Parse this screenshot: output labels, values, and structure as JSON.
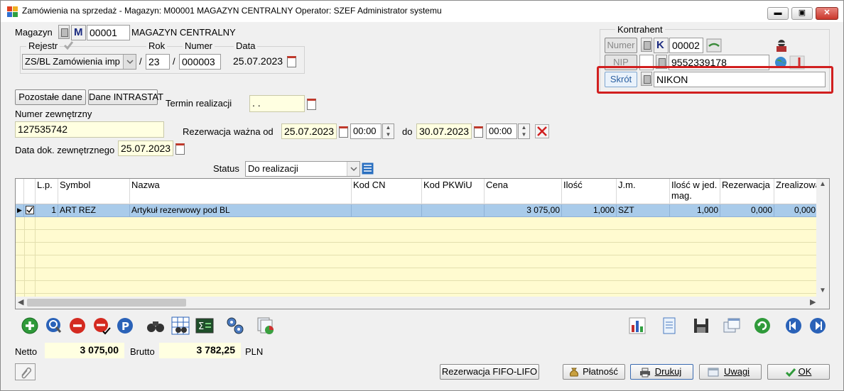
{
  "window": {
    "title": "Zamówienia na sprzedaż - Magazyn: M00001 MAGAZYN CENTRALNY  Operator: SZEF Administrator systemu",
    "min_label": "▬",
    "max_label": "▣",
    "close_label": "✕"
  },
  "magazyn": {
    "label": "Magazyn",
    "prefix": "M",
    "code": "00001",
    "name": "MAGAZYN CENTRALNY"
  },
  "rejestr": {
    "label": "Rejestr",
    "value": "ZS/BL Zamówienia imp",
    "rok_label": "Rok",
    "rok": "23",
    "numer_label": "Numer",
    "numer": "000003",
    "data_label": "Data",
    "data": "25.07.2023",
    "sep1": "/",
    "sep2": "/"
  },
  "kontrahent": {
    "label": "Kontrahent",
    "numer_label": "Numer",
    "prefix": "K",
    "numer": "00002",
    "nip_label": "NIP",
    "nip": "9552339178",
    "skrot_label": "Skrót",
    "skrot": "NIKON"
  },
  "buttons": {
    "pozostale": "Pozostałe dane",
    "intrastat": "Dane INTRASTAT",
    "fifo": "Rezerwacja FIFO-LIFO",
    "platnosc": "Płatność",
    "drukuj": "Drukuj",
    "uwagi": "Uwagi",
    "ok": "OK"
  },
  "termin": {
    "label": "Termin realizacji",
    "value": " .  ."
  },
  "numer_zew": {
    "label": "Numer zewnętrzny",
    "value": "127535742"
  },
  "rezerwacja": {
    "label": "Rezerwacja",
    "wazna_label": "ważna od",
    "od_date": "25.07.2023",
    "od_time": "00:00",
    "do_label": "do",
    "do_date": "30.07.2023",
    "do_time": "00:00"
  },
  "data_zew": {
    "label": "Data dok. zewnętrznego",
    "value": "25.07.2023"
  },
  "status": {
    "label": "Status",
    "value": "Do realizacji"
  },
  "grid": {
    "columns": [
      "L.p.",
      "Symbol",
      "Nazwa",
      "Kod CN",
      "Kod PKWiU",
      "Cena",
      "Ilość",
      "J.m.",
      "Ilość w jed. mag.",
      "Rezerwacja",
      "Zrealizowa"
    ],
    "rows": [
      {
        "lp": "1",
        "symbol": "ART REZ",
        "nazwa": "Artykuł rezerwowy pod BL",
        "kodcn": "",
        "pkwiu": "",
        "cena": "3 075,00",
        "ilosc": "1,000",
        "jm": "SZT",
        "iloscmag": "1,000",
        "rezerwacja": "0,000",
        "zreal": "0,000"
      }
    ]
  },
  "totals": {
    "netto_label": "Netto",
    "netto": "3 075,00",
    "brutto_label": "Brutto",
    "brutto": "3 782,25",
    "currency": "PLN"
  },
  "colors": {
    "highlight": "#d11f1f",
    "selected_row": "#a9cbea",
    "grid_bg": "#fffbd0",
    "field_yellow": "#ffffe1"
  }
}
